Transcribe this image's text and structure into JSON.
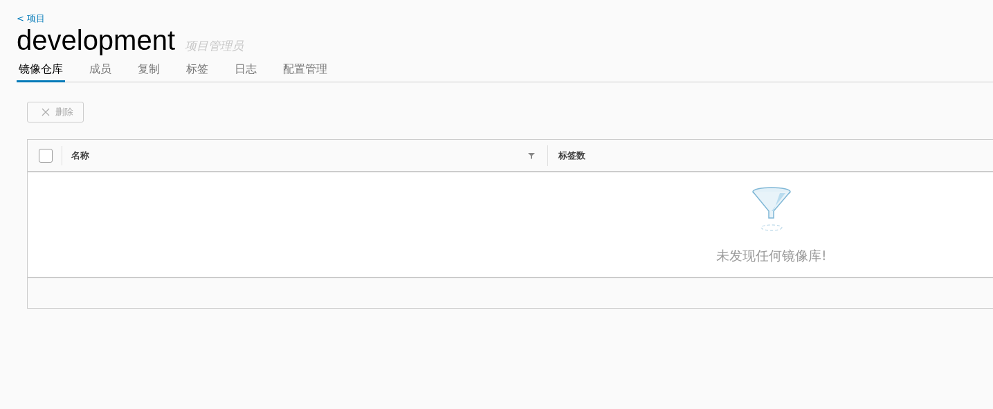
{
  "breadcrumb": {
    "label": "< 项目"
  },
  "header": {
    "title": "development",
    "role": "项目管理员"
  },
  "tabs": [
    {
      "label": "镜像仓库",
      "selected": true
    },
    {
      "label": "成员",
      "selected": false
    },
    {
      "label": "复制",
      "selected": false
    },
    {
      "label": "标签",
      "selected": false
    },
    {
      "label": "日志",
      "selected": false
    },
    {
      "label": "配置管理",
      "selected": false
    }
  ],
  "toolbar": {
    "delete_button": {
      "label": "删除",
      "disabled": true
    }
  },
  "table": {
    "select_all": {
      "checked": false
    },
    "columns": [
      {
        "label": "名称",
        "filter": true
      },
      {
        "label": "标签数",
        "filter": false
      }
    ],
    "empty_message": "未发现任何镜像库!"
  }
}
